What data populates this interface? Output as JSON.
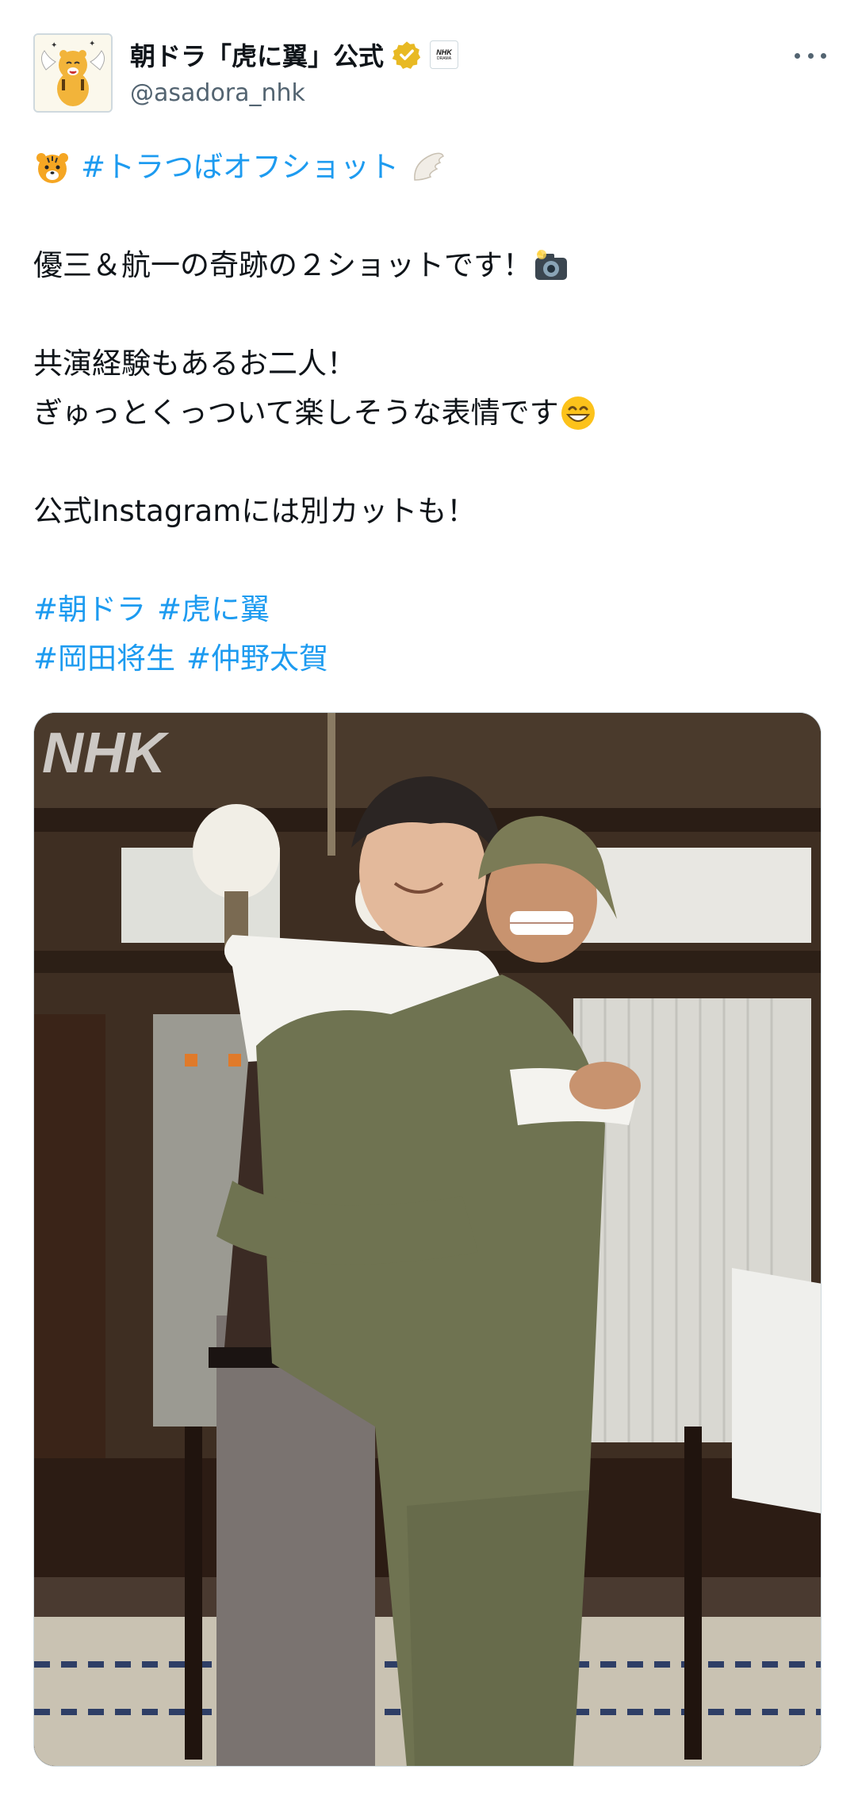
{
  "header": {
    "display_name": "朝ドラ「虎に翼」公式",
    "handle": "@asadora_nhk",
    "affiliate_badge_line1": "NHK",
    "affiliate_badge_line2": "DRAMA",
    "avatar_icon": "tiger-mascot-icon",
    "verified_icon": "gold-verified-badge-icon",
    "more_icon": "more-dots-icon"
  },
  "post": {
    "line1_tag": "#トラつばオフショット",
    "line1_emojis": [
      "tiger-face-emoji",
      "wing-emoji"
    ],
    "line2": "優三＆航一の奇跡の２ショットです！",
    "line2_emoji": "camera-with-flash-emoji",
    "line3": "共演経験もあるお二人！",
    "line4": "ぎゅっとくっついて楽しそうな表情です",
    "line4_emoji": "grinning-face-emoji",
    "line5": "公式Instagramには別カットも！",
    "hashtags_row1": [
      "#朝ドラ",
      "#虎に翼"
    ],
    "hashtags_row2": [
      "#岡田将生",
      "#仲野太賀"
    ]
  },
  "media": {
    "watermark": "NHK",
    "description_icon": "photo-two-actors-hugging"
  },
  "colors": {
    "link": "#1d9bf0",
    "text": "#0f1419",
    "secondary": "#536471",
    "verified": "#e8b923"
  }
}
